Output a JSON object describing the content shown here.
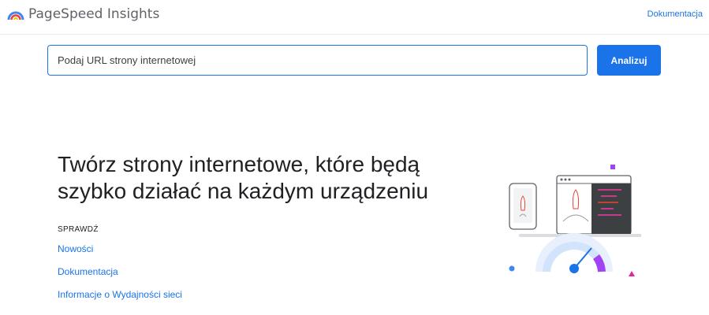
{
  "header": {
    "app_name": "PageSpeed Insights",
    "docs_link": "Dokumentacja"
  },
  "search": {
    "placeholder": "Podaj URL strony internetowej",
    "value": "",
    "button_label": "Analizuj"
  },
  "hero": {
    "title_line1": "Twórz strony internetowe, które będą",
    "title_line2": "szybko działać na każdym urządzeniu"
  },
  "links_section": {
    "label": "SPRAWDŹ",
    "items": [
      {
        "label": "Nowości"
      },
      {
        "label": "Dokumentacja"
      },
      {
        "label": "Informacje o Wydajności sieci"
      }
    ]
  },
  "icons": {
    "logo": "pagespeed-gauge-icon",
    "illustration": "devices-rocket-gauge-illustration"
  },
  "colors": {
    "accent": "#1a73e8",
    "divider": "#e8eaed",
    "text": "#202124"
  }
}
